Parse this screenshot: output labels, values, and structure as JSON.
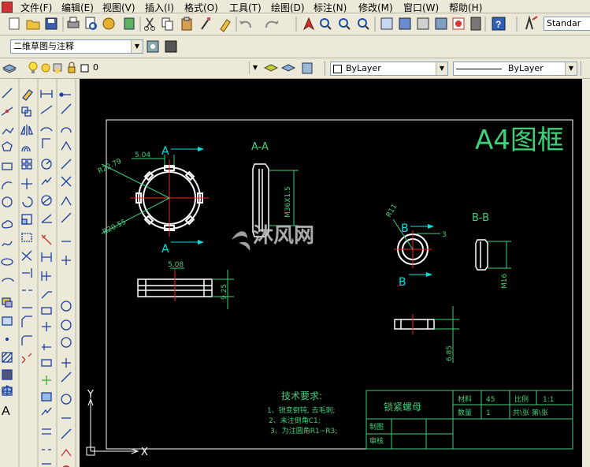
{
  "menu": [
    "文件(F)",
    "编辑(E)",
    "视图(V)",
    "插入(I)",
    "格式(O)",
    "工具(T)",
    "绘图(D)",
    "标注(N)",
    "修改(M)",
    "窗口(W)",
    "帮助(H)"
  ],
  "toolbar2": {
    "text_style": "Standar"
  },
  "toolbar3": {
    "workspace": "二维草图与注释"
  },
  "toolbar4": {
    "layer": "0",
    "color": "ByLayer",
    "linetype": "ByLayer"
  },
  "drawing": {
    "frame_title": "A4图框",
    "section_aa": "A-A",
    "section_bb": "B-B",
    "label_a_top": "A",
    "label_a_bottom": "A",
    "label_b_top": "B",
    "label_b_bottom": "B",
    "dim_504": "5.04",
    "dim_r2279": "R22.79",
    "dim_r2055": "R20.55",
    "dim_m36": "M36X1.5",
    "dim_508": "5.08",
    "dim_925": "9.25",
    "dim_r11": "R11",
    "dim_3": "3",
    "dim_m16": "M16",
    "dim_685": "6.85",
    "tech_title": "技术要求:",
    "tech_1": "1、锐变倒钝, 去毛刺;",
    "tech_2": "2、未注倒角C1;",
    "tech_3": "3、为注圆角R1~R3;",
    "part_name": "锁紧螺母",
    "tb_material_label": "材料",
    "tb_material": "45",
    "tb_scale_label": "比例",
    "tb_scale": "1:1",
    "tb_qty_label": "数量",
    "tb_qty": "1",
    "tb_sheet": "共\\张 第\\张",
    "tb_draw": "制图",
    "tb_check": "审核",
    "watermark": "沐风网",
    "axis_x": "X",
    "axis_y": "Y"
  },
  "colors": {
    "cad_green": "#3fd07a",
    "cad_cyan": "#00e0e0",
    "cad_red": "#ff2020",
    "cad_white": "#ffffff",
    "cad_yellow": "#e0e000"
  }
}
